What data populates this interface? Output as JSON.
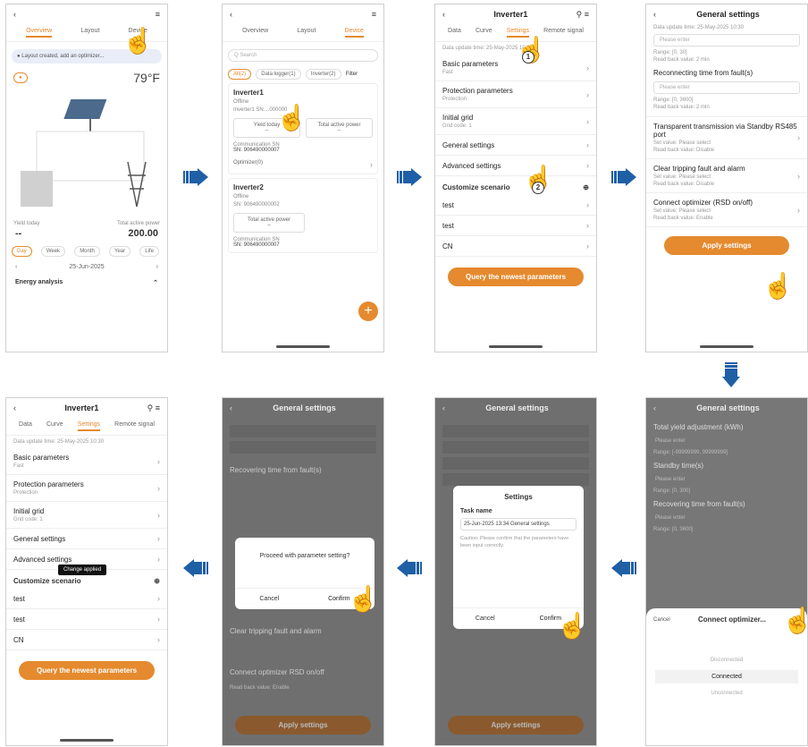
{
  "s1": {
    "tabs": [
      "Overview",
      "Layout",
      "Device"
    ],
    "banner": "Layout created, add an optimizer...",
    "temp": "79°F",
    "stat_left_label": "Yield today",
    "stat_left_value": "--",
    "stat_right_label": "Total active power",
    "stat_right_value": "200.00",
    "periods": [
      "Day",
      "Week",
      "Month",
      "Year",
      "Life"
    ],
    "date": "25-Jun-2025",
    "energy": "Energy analysis"
  },
  "s2": {
    "tabs": [
      "Overview",
      "Layout",
      "Device"
    ],
    "search_placeholder": "Q Search",
    "filters": [
      "All(2)",
      "Data logger(1)",
      "Inverter(2)",
      "Filter"
    ],
    "inv1": "Inverter1",
    "inv1_status": "Offline",
    "inv1_sn": "Inverter1 SN:...000000",
    "yield": "Yield today",
    "yield_val": "--",
    "power": "Total active power",
    "power_val": "--",
    "comm": "Communication SN",
    "comm_val": "SN: 906490000007",
    "optimizer": "Optimizer(0)",
    "inv2": "Inverter2",
    "inv2_status": "Offline",
    "inv2_sn": "SN: 906490000002",
    "power2": "Total active power",
    "power2_val": "--",
    "comm2": "Communication SN",
    "comm2_val": "SN: 906490000007"
  },
  "s3": {
    "title": "Inverter1",
    "tabs": [
      "Data",
      "Curve",
      "Settings",
      "Remote signal"
    ],
    "updated": "Data update time: 25-May-2025 10:30",
    "rows": [
      {
        "label": "Basic parameters",
        "sub": "Fast"
      },
      {
        "label": "Protection parameters",
        "sub": "Protection"
      },
      {
        "label": "Initial grid",
        "sub": "Grid code: 1"
      },
      {
        "label": "General settings",
        "sub": ""
      },
      {
        "label": "Advanced settings",
        "sub": ""
      }
    ],
    "customize": "Customize scenario",
    "cust_rows": [
      "test",
      "test",
      "CN"
    ],
    "button": "Query the newest parameters",
    "badge1": "1",
    "badge2": "2"
  },
  "s4": {
    "title": "General settings",
    "updated": "Data update time: 25-May-2025 10:30",
    "placeholder": "Please enter",
    "range1": "Range: [0, 30]",
    "readback1": "Read back value: 2 min",
    "label2": "Reconnecting time from fault(s)",
    "range2": "Range: [0, 3600]",
    "readback2": "Read back value: 2 min",
    "label3": "Transparent transmission via Standby RS485 port",
    "setval3": "Set value: Please select",
    "readback3": "Read back value: Disable",
    "label4": "Clear tripping fault and alarm",
    "setval4": "Set value: Please select",
    "readback4": "Read back value: Disable",
    "label5": "Connect optimizer (RSD on/off)",
    "setval5": "Set value: Please select",
    "readback5": "Read back value: Enable",
    "button": "Apply settings"
  },
  "s5": {
    "title": "Inverter1",
    "tabs": [
      "Data",
      "Curve",
      "Settings",
      "Remote signal"
    ],
    "updated": "Data update time: 25-May-2025 10:30",
    "rows": [
      {
        "label": "Basic parameters",
        "sub": "Fast"
      },
      {
        "label": "Protection parameters",
        "sub": "Protection"
      },
      {
        "label": "Initial grid",
        "sub": "Grid code: 1"
      },
      {
        "label": "General settings",
        "sub": ""
      },
      {
        "label": "Advanced settings",
        "sub": ""
      }
    ],
    "toast": "Change applied",
    "customize": "Customize scenario",
    "cust_rows": [
      "test",
      "test",
      "CN"
    ],
    "button": "Query the newest parameters"
  },
  "s6": {
    "title": "General settings",
    "dialog_msg": "Proceed with parameter setting?",
    "cancel": "Cancel",
    "confirm": "Confirm",
    "label2": "Recovering time from fault(s)",
    "label3": "Clear tripping fault and alarm",
    "label4": "Connect optimizer RSD on/off",
    "readback": "Read back value: Enable",
    "button": "Apply settings"
  },
  "s7": {
    "title": "General settings",
    "dialog_title": "Settings",
    "task_label": "Task name",
    "task_value": "25-Jun-2025 13:34 General settings",
    "dialog_note": "Caution: Please confirm that the parameters have been input correctly.",
    "cancel": "Cancel",
    "confirm": "Confirm",
    "button": "Apply settings"
  },
  "s8": {
    "title": "General settings",
    "label1": "Total yield adjustment (kWh)",
    "placeholder": "Please enter",
    "range1": "Range: [-99999999, 99999999]",
    "label2": "Standby time(s)",
    "range2": "Range: [0, 300]",
    "label3": "Recovering time from fault(s)",
    "range3": "Range: [0, 3600]",
    "sheet_cancel": "Cancel",
    "sheet_title": "Connect optimizer...",
    "opt1": "Disconnected",
    "opt2": "Connected",
    "opt3": "Unconnected"
  }
}
